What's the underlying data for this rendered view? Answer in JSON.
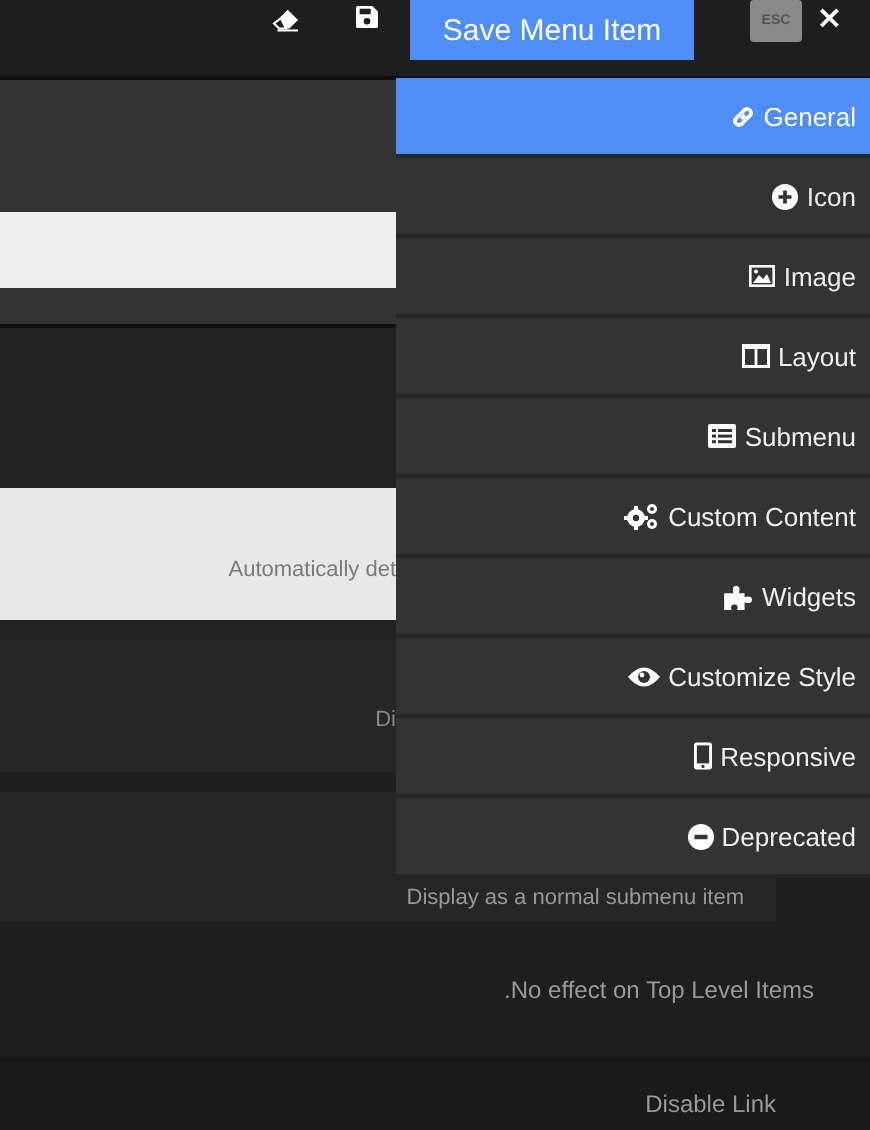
{
  "toolbar": {
    "save_button": "Save Menu Item",
    "esc_key": "ESC",
    "close": "×"
  },
  "menu": [
    {
      "label": "General",
      "selected": true
    },
    {
      "label": "Icon",
      "selected": false
    },
    {
      "label": "Image",
      "selected": false
    },
    {
      "label": "Layout",
      "selected": false
    },
    {
      "label": "Submenu",
      "selected": false
    },
    {
      "label": "Custom Content",
      "selected": false
    },
    {
      "label": "Widgets",
      "selected": false
    },
    {
      "label": "Customize Style",
      "selected": false
    },
    {
      "label": "Responsive",
      "selected": false
    },
    {
      "label": "Deprecated",
      "selected": false
    }
  ],
  "settings": {
    "hint_1": "Automatically det",
    "hint_2": "Di",
    "hint_3": "Display as a normal submenu item",
    "hint_4": ".No effect on Top Level Items",
    "label_5": "Disable Link"
  }
}
